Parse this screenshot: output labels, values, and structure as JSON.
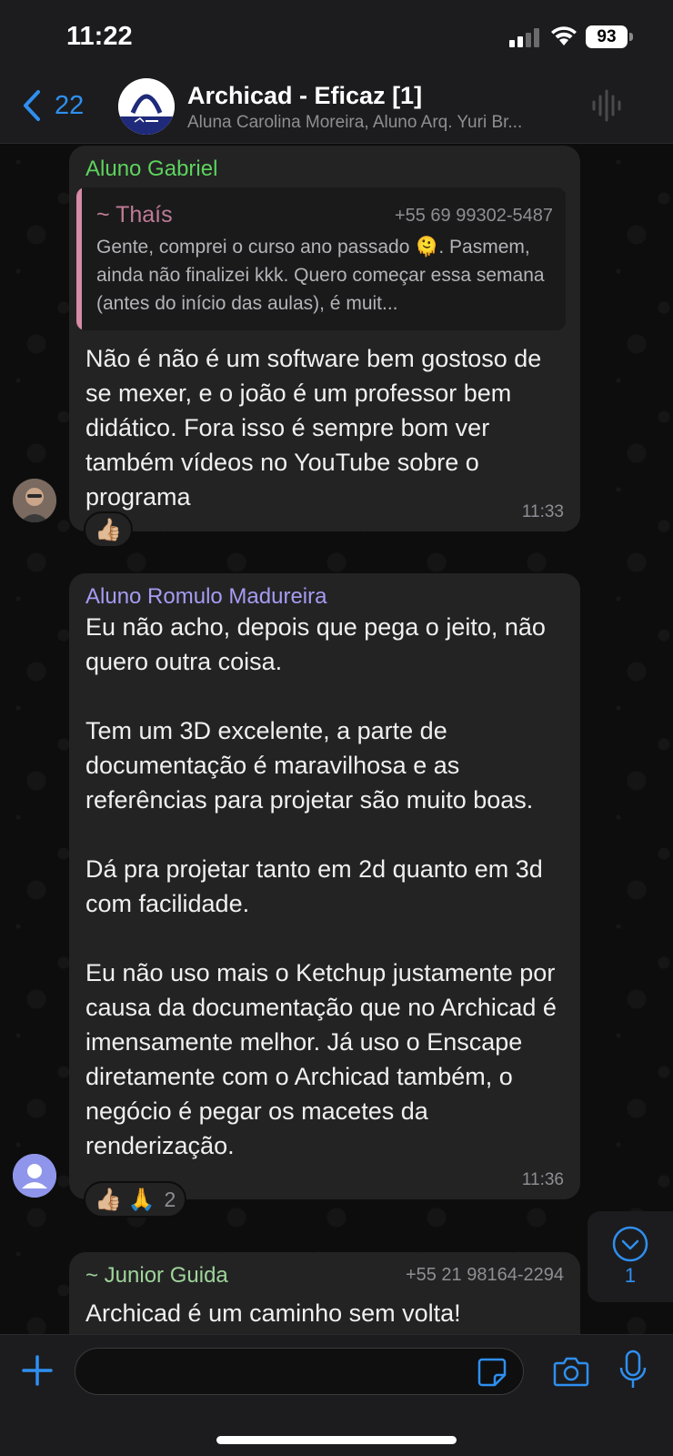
{
  "status_bar": {
    "time": "11:22",
    "battery": "93"
  },
  "header": {
    "back_count": "22",
    "title": "Archicad - Eficaz [1]",
    "members": "Aluna Carolina Moreira, Aluno Arq. Yuri Br..."
  },
  "messages": [
    {
      "sender": "Aluno Gabriel",
      "sender_color": "#5dd35d",
      "quote": {
        "author": "~ Thaís",
        "phone": "+55 69 99302-5487",
        "text": "Gente, comprei o curso ano passado 🫠. Pasmem, ainda não finalizei kkk. Quero começar essa semana (antes do início das aulas), é muit..."
      },
      "text": "Não é não é um software bem gostoso de se mexer, e o joão é um professor bem didático. Fora isso é sempre bom ver também vídeos no YouTube sobre o programa",
      "time": "11:33",
      "reactions": "👍🏼"
    },
    {
      "sender": "Aluno Romulo Madureira",
      "sender_color": "#a59cf2",
      "text": "Eu não acho, depois que pega o jeito, não quero outra coisa.\n\nTem um 3D excelente, a parte de documentação é maravilhosa e as referências para projetar são muito boas.\n\nDá pra projetar tanto em 2d quanto em 3d com facilidade.\n\nEu não uso mais o Ketchup justamente por causa da documentação que no Archicad é imensamente melhor. Já uso o Enscape diretamente com o Archicad também, o negócio é pegar os macetes da renderização.",
      "time": "11:36",
      "reactions": "👍🏼 🙏",
      "reaction_count": "2"
    },
    {
      "sender": "~ Junior Guida",
      "sender_color": "#9fd49a",
      "phone": "+55 21 98164-2294",
      "text": "Archicad é um caminho sem volta!"
    }
  ],
  "scroll_down": {
    "unread": "1"
  },
  "colors": {
    "accent": "#2f8ff0",
    "bubble": "#232324",
    "bar": "#1c1c1e"
  }
}
